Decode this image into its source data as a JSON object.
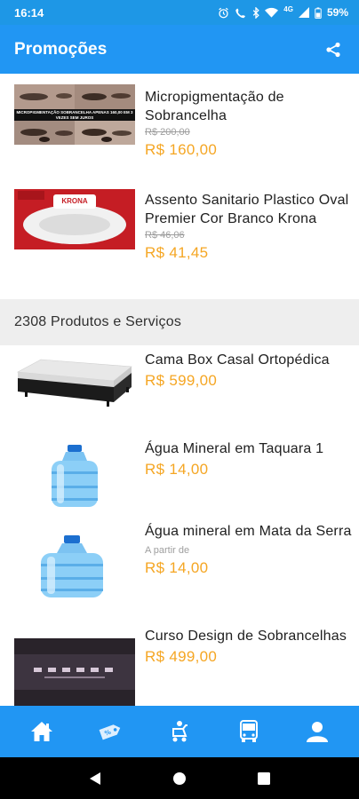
{
  "status_bar": {
    "time": "16:14",
    "network": "4G",
    "battery": "59%"
  },
  "app_bar": {
    "title": "Promoções",
    "share_icon": "share-icon"
  },
  "promotions": [
    {
      "image_caption": "MICROPIGMENTAÇÃO SOBRANCELHA APENAS 160,00 EM 3 VEZES SEM JUROS",
      "title": "Micropigmentação de Sobrancelha",
      "old_price": "R$ 200,00",
      "price": "R$  160,00"
    },
    {
      "image_caption": "KRONA",
      "title": "Assento Sanitario Plastico Oval Premier Cor Branco Krona",
      "old_price": "R$ 46,06",
      "price": "R$  41,45"
    }
  ],
  "products_header": "2308 Produtos e Serviços",
  "products": [
    {
      "title": "Cama Box Casal Ortopédica",
      "price": "R$  599,00"
    },
    {
      "title": "Água Mineral em Taquara 1",
      "price": "R$  14,00"
    },
    {
      "title": "Água mineral em Mata da Serra",
      "from_label": "A partir de",
      "price": "R$  14,00"
    },
    {
      "title": "Curso Design de Sobrancelhas",
      "price": "R$  499,00"
    }
  ],
  "bottom_nav": [
    {
      "icon": "home-icon"
    },
    {
      "icon": "tag-icon"
    },
    {
      "icon": "stroller-icon"
    },
    {
      "icon": "bus-icon"
    },
    {
      "icon": "user-icon"
    }
  ],
  "system_nav": [
    {
      "icon": "back-icon"
    },
    {
      "icon": "home-circle-icon"
    },
    {
      "icon": "recents-icon"
    }
  ],
  "colors": {
    "primary": "#2196f3",
    "status_bar": "#1e97e6",
    "price": "#f5a623",
    "section_bg": "#eeeeee"
  }
}
